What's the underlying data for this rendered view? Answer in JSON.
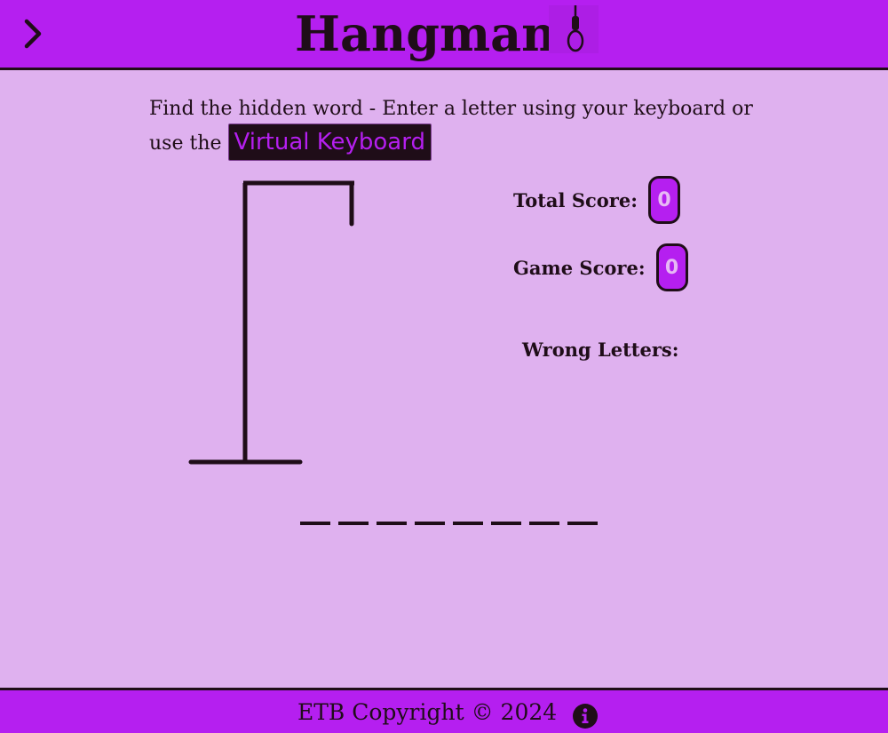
{
  "header": {
    "title": "Hangman",
    "menu_icon": "chevron-right-icon",
    "logo_icon": "noose-icon"
  },
  "instructions": {
    "line_text": "Find the hidden word - Enter a letter using your keyboard or use the",
    "virtual_keyboard_label": "Virtual Keyboard"
  },
  "scores": {
    "total_label": "Total Score:",
    "total_value": "0",
    "game_label": "Game Score:",
    "game_value": "0"
  },
  "wrong_letters": {
    "label": "Wrong Letters:",
    "letters": ""
  },
  "word": {
    "slots": [
      "",
      "",
      "",
      "",
      "",
      "",
      "",
      ""
    ]
  },
  "footer": {
    "copyright": "ETB Copyright © 2024",
    "info_icon": "info-icon"
  },
  "colors": {
    "background": "#dfb1ef",
    "accent": "#b51ff0",
    "dark": "#1f0d18"
  }
}
